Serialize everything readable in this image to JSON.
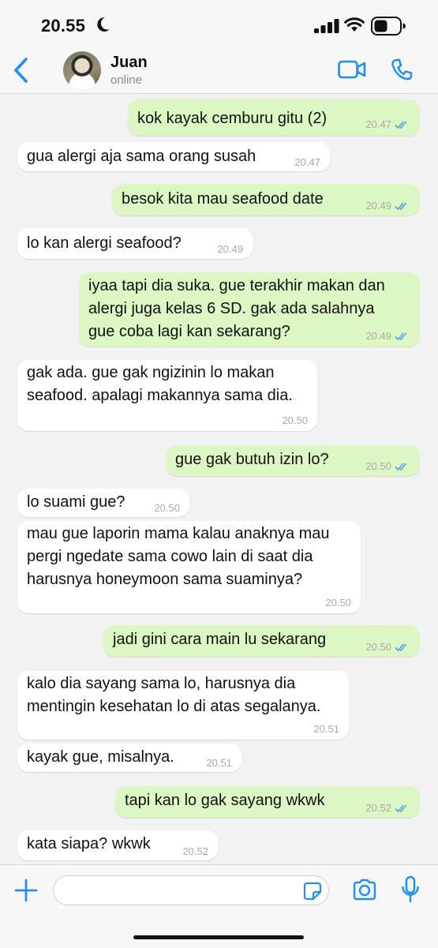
{
  "status_bar": {
    "time": "20.55"
  },
  "header": {
    "contact_name": "Juan",
    "presence": "online"
  },
  "colors": {
    "accent": "#1e8ef5",
    "outgoing_bubble": "#dcf7c4",
    "incoming_bubble": "#ffffff",
    "read_ticks": "#4ea5e8"
  },
  "icons": [
    "moon-icon",
    "signal-icon",
    "wifi-icon",
    "battery-icon",
    "back-arrow-icon",
    "video-call-icon",
    "phone-call-icon",
    "plus-icon",
    "sticker-icon",
    "camera-icon",
    "microphone-icon"
  ],
  "messages": [
    {
      "dir": "out",
      "text": "kok kayak cemburu gitu (2)",
      "time": "20.47",
      "read": true
    },
    {
      "dir": "in",
      "text": "gua alergi aja sama orang susah",
      "time": "20.47"
    },
    {
      "dir": "out",
      "text": "besok kita mau seafood date",
      "time": "20.49",
      "read": true
    },
    {
      "dir": "in",
      "text": "lo kan alergi seafood?",
      "time": "20.49"
    },
    {
      "dir": "out",
      "text": "iyaa tapi dia suka. gue terakhir makan dan\nalergi juga kelas 6 SD. gak ada salahnya\ngue coba lagi kan sekarang?",
      "time": "20.49",
      "read": true
    },
    {
      "dir": "in",
      "text": "gak ada. gue gak ngizinin lo makan\nseafood. apalagi makannya sama dia.",
      "time": "20.50"
    },
    {
      "dir": "out",
      "text": "gue gak butuh izin lo?",
      "time": "20.50",
      "read": true
    },
    {
      "dir": "in",
      "text": "lo suami gue?",
      "time": "20.50"
    },
    {
      "dir": "in",
      "text": "mau gue laporin mama kalau anaknya mau\npergi ngedate sama cowo lain di saat dia\nharusnya honeymoon sama suaminya?",
      "time": "20.50"
    },
    {
      "dir": "out",
      "text": "jadi gini cara main lu sekarang",
      "time": "20.50",
      "read": true
    },
    {
      "dir": "in",
      "text": "kalo dia sayang sama lo, harusnya dia\nmentingin kesehatan lo di atas segalanya.",
      "time": "20.51"
    },
    {
      "dir": "in",
      "text": "kayak gue, misalnya.",
      "time": "20.51"
    },
    {
      "dir": "out",
      "text": "tapi kan lo gak sayang wkwk",
      "time": "20.52",
      "read": true
    },
    {
      "dir": "in",
      "text": "kata siapa? wkwk",
      "time": "20.52"
    }
  ],
  "composer": {
    "value": ""
  }
}
